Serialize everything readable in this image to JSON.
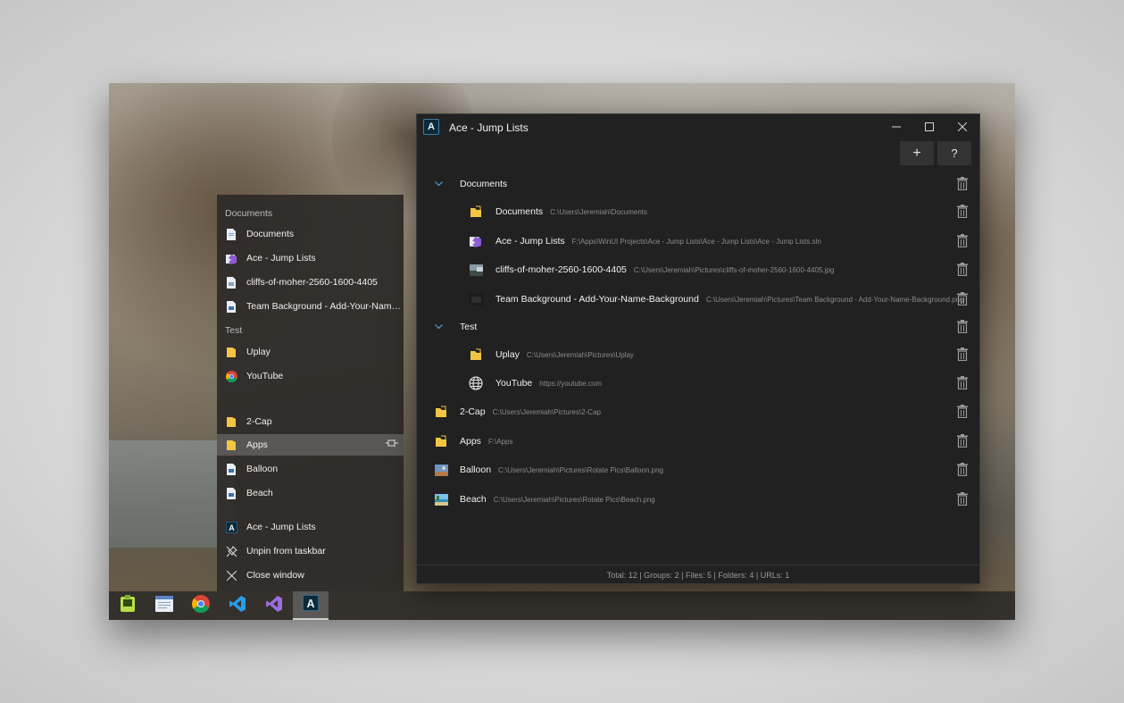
{
  "jumplist": {
    "groups": [
      {
        "header": "Documents",
        "items": [
          {
            "label": "Documents",
            "icon": "document-icon"
          },
          {
            "label": "Ace - Jump Lists",
            "icon": "visual-studio-solution-icon"
          },
          {
            "label": "cliffs-of-moher-2560-1600-4405",
            "icon": "document-icon"
          },
          {
            "label": "Team Background - Add-Your-Name-B...",
            "icon": "document-icon"
          }
        ]
      },
      {
        "header": "Test",
        "items": [
          {
            "label": "Uplay",
            "icon": "folder-icon"
          },
          {
            "label": "YouTube",
            "icon": "chrome-icon"
          }
        ]
      }
    ],
    "pinned": [
      {
        "label": "2-Cap",
        "icon": "folder-icon"
      },
      {
        "label": "Apps",
        "icon": "folder-icon"
      },
      {
        "label": "Balloon",
        "icon": "document-icon"
      },
      {
        "label": "Beach",
        "icon": "document-icon"
      }
    ],
    "tasks": [
      {
        "label": "Ace - Jump Lists",
        "icon": "ace-app-icon"
      },
      {
        "label": "Unpin from taskbar",
        "icon": "unpin-icon"
      },
      {
        "label": "Close window",
        "icon": "close-icon"
      }
    ]
  },
  "taskbar": {
    "apps": [
      "tasks-app-icon",
      "notepad-icon",
      "chrome-icon",
      "vscode-icon",
      "visual-studio-icon",
      "ace-app-icon"
    ]
  },
  "window": {
    "title": "Ace - Jump Lists",
    "logo_letter": "A",
    "add_label": "+",
    "help_label": "?",
    "groups": [
      {
        "name": "Documents",
        "items": [
          {
            "name": "Documents",
            "path": "C:\\Users\\Jeremiah\\Documents",
            "icon": "folder-icon"
          },
          {
            "name": "Ace - Jump Lists",
            "path": "F:\\Apps\\WinUI Projects\\Ace - Jump Lists\\Ace - Jump Lists\\Ace - Jump Lists.sln",
            "icon": "visual-studio-solution-icon"
          },
          {
            "name": "cliffs-of-moher-2560-1600-4405",
            "path": "C:\\Users\\Jeremiah\\Pictures\\cliffs-of-moher-2560-1600-4405.jpg",
            "icon": "image-thumbnail-icon"
          },
          {
            "name": "Team Background - Add-Your-Name-Background",
            "path": "C:\\Users\\Jeremiah\\Pictures\\Team Background - Add-Your-Name-Background.png",
            "icon": "image-thumbnail-icon"
          }
        ]
      },
      {
        "name": "Test",
        "items": [
          {
            "name": "Uplay",
            "path": "C:\\Users\\Jeremiah\\Pictures\\Uplay",
            "icon": "folder-icon"
          },
          {
            "name": "YouTube",
            "path": "https://youtube.com",
            "icon": "globe-icon"
          }
        ]
      }
    ],
    "items": [
      {
        "name": "2-Cap",
        "path": "C:\\Users\\Jeremiah\\Pictures\\2-Cap",
        "icon": "folder-icon"
      },
      {
        "name": "Apps",
        "path": "F:\\Apps",
        "icon": "folder-icon"
      },
      {
        "name": "Balloon",
        "path": "C:\\Users\\Jeremiah\\Pictures\\Rotate Pics\\Balloon.png",
        "icon": "image-thumbnail-icon"
      },
      {
        "name": "Beach",
        "path": "C:\\Users\\Jeremiah\\Pictures\\Rotate Pics\\Beach.png",
        "icon": "image-thumbnail-icon"
      }
    ],
    "status": "Total: 12 | Groups: 2 | Files: 5 | Folders: 4 | URLs: 1"
  },
  "colors": {
    "accent": "#4aa3df",
    "folder": "#f4c542",
    "window_bg": "#212121"
  }
}
